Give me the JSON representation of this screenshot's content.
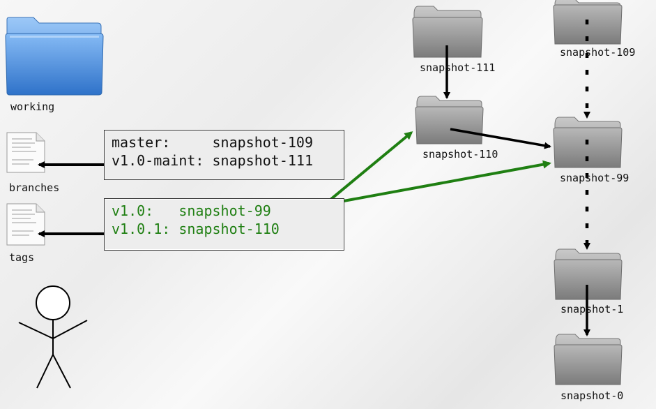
{
  "local": {
    "working_label": "working",
    "branches_label": "branches",
    "tags_label": "tags"
  },
  "branches_box": {
    "rows": [
      {
        "name": "master:     ",
        "value": "snapshot-109"
      },
      {
        "name": "v1.0-maint: ",
        "value": "snapshot-111"
      }
    ]
  },
  "tags_box": {
    "rows": [
      {
        "name": "v1.0:   ",
        "value": "snapshot-99"
      },
      {
        "name": "v1.0.1: ",
        "value": "snapshot-110"
      }
    ]
  },
  "snapshots": {
    "s111": "snapshot-111",
    "s110": "snapshot-110",
    "s109": "snapshot-109",
    "s99": "snapshot-99",
    "s1": "snapshot-1",
    "s0": "snapshot-0"
  },
  "colors": {
    "working_folder": "#5b9be6",
    "snapshot_folder": "#9a9a9a",
    "tag_green": "#1f7f12",
    "arrow_black": "#000000",
    "text": "#111111"
  },
  "icons": {
    "working": "blue-folder-icon",
    "snapshot": "gray-folder-icon",
    "branches": "document-icon",
    "tags": "document-icon",
    "person": "stick-figure-icon"
  }
}
